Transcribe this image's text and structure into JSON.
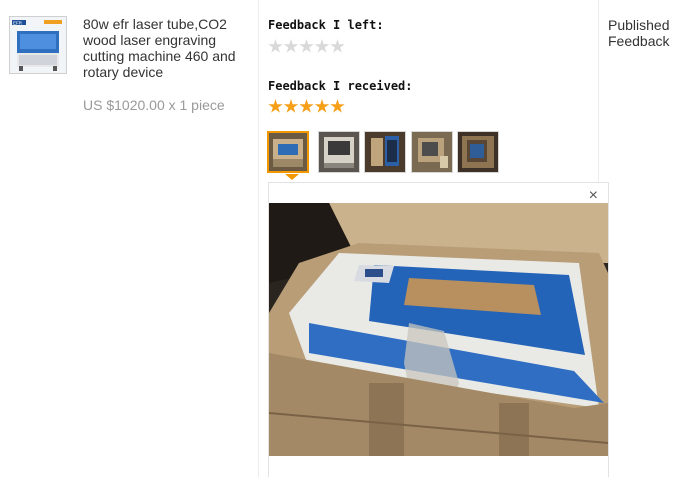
{
  "product": {
    "title": "80w efr laser tube,CO2 wood laser engraving cutting machine 460 and rotary device",
    "price_line": "US $1020.00 x 1 piece",
    "thumbnail_brand_text": "EFR"
  },
  "feedback": {
    "left_label": "Feedback I left:",
    "left_rating": 0,
    "received_label": "Feedback I received:",
    "received_rating": 5,
    "star_count": 5,
    "photo_thumbnails": [
      "photo-1",
      "photo-2",
      "photo-3",
      "photo-4",
      "photo-5"
    ],
    "selected_photo_index": 0,
    "close_symbol": "×"
  },
  "status": {
    "label": "Published Feedback"
  },
  "colors": {
    "star_full": "#f6a01a",
    "star_empty": "#d9d9d9",
    "active_thumb_border": "#f39800"
  }
}
